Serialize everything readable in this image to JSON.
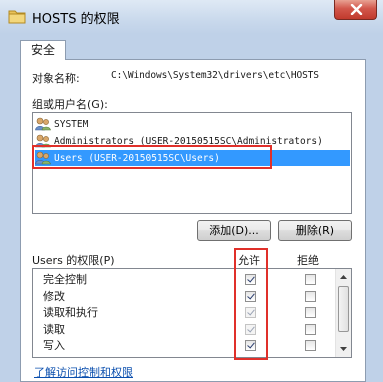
{
  "window": {
    "title": "HOSTS 的权限",
    "icon": "folder-icon"
  },
  "tab": {
    "label": "安全"
  },
  "object": {
    "label": "对象名称:",
    "path": "C:\\Windows\\System32\\drivers\\etc\\HOSTS"
  },
  "groups": {
    "label": "组或用户名(G):",
    "items": [
      {
        "name": "SYSTEM",
        "icon": "user-group-icon",
        "selected": false
      },
      {
        "name": "Administrators (USER-20150515SC\\Administrators)",
        "icon": "user-group-icon",
        "selected": false
      },
      {
        "name": "Users (USER-20150515SC\\Users)",
        "icon": "user-group-icon",
        "selected": true
      }
    ]
  },
  "buttons": {
    "add": "添加(D)...",
    "remove": "删除(R)"
  },
  "permissions": {
    "header": "Users 的权限(P)",
    "allow_header": "允许",
    "deny_header": "拒绝",
    "rows": [
      {
        "label": "完全控制",
        "allow": true,
        "allow_disabled": false,
        "deny": false
      },
      {
        "label": "修改",
        "allow": true,
        "allow_disabled": false,
        "deny": false
      },
      {
        "label": "读取和执行",
        "allow": true,
        "allow_disabled": true,
        "deny": false
      },
      {
        "label": "读取",
        "allow": true,
        "allow_disabled": true,
        "deny": false
      },
      {
        "label": "写入",
        "allow": true,
        "allow_disabled": false,
        "deny": false
      }
    ]
  },
  "link": {
    "label": "了解访问控制和权限"
  },
  "colors": {
    "selection": "#3399ff",
    "highlight_box": "#e0302a",
    "link": "#0b4fae"
  }
}
